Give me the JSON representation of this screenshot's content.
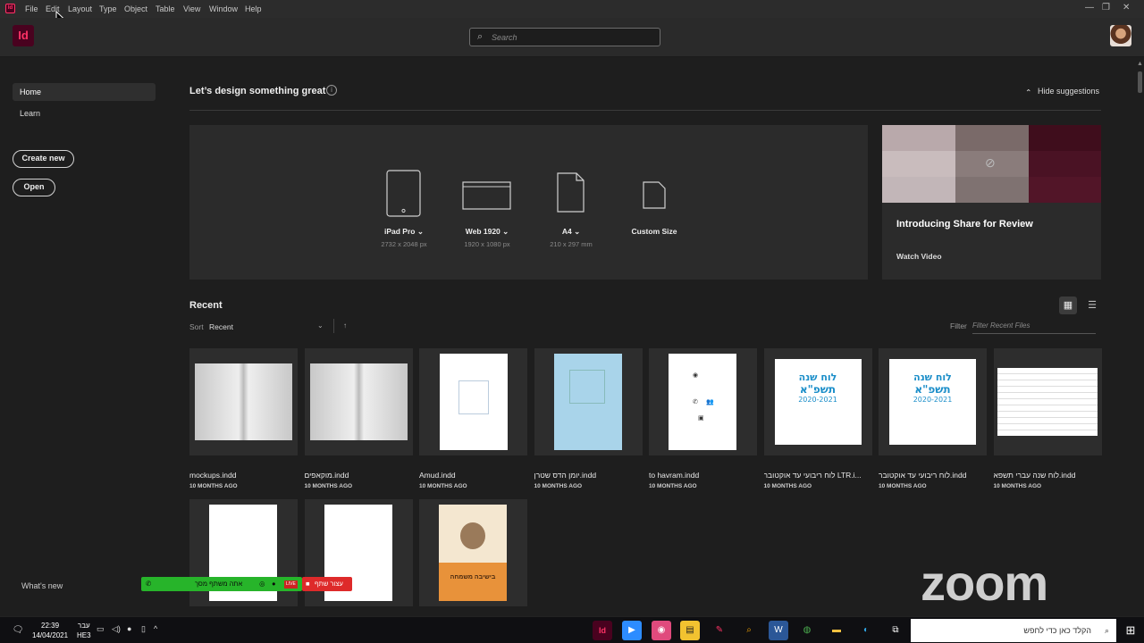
{
  "menubar": {
    "items": [
      "File",
      "Edit",
      "Layout",
      "Type",
      "Object",
      "Table",
      "View",
      "Window",
      "Help"
    ],
    "controls": [
      "—",
      "❐",
      "✕"
    ]
  },
  "app": {
    "logo": "Id"
  },
  "search": {
    "placeholder": "Search"
  },
  "sidebar": {
    "items": [
      {
        "label": "Home",
        "active": true
      },
      {
        "label": "Learn",
        "active": false
      }
    ],
    "create_label": "Create new",
    "open_label": "Open",
    "whats_new": "What's new"
  },
  "main": {
    "heading": "Let’s design something great",
    "hide_label": "Hide suggestions",
    "presets": [
      {
        "name": "iPad Pro",
        "size": "2732 x 2048 px",
        "icon": "tablet-icon",
        "dropdown": true
      },
      {
        "name": "Web 1920",
        "size": "1920 x 1080 px",
        "icon": "browser-window-icon",
        "dropdown": true
      },
      {
        "name": "A4",
        "size": "210 x 297 mm",
        "icon": "document-icon",
        "dropdown": true
      },
      {
        "name": "Custom Size",
        "size": "",
        "icon": "custom-document-icon",
        "dropdown": false
      }
    ],
    "promo": {
      "title": "Introducing Share for Review",
      "link": "Watch Video",
      "swatches": [
        "#b9a9ab",
        "#7a6a69",
        "#3f0d1c",
        "#c9bcbd",
        "#8a7c7b",
        "#4a1224",
        "#c2b6b8",
        "#7f7271",
        "#521528"
      ]
    },
    "recent": {
      "heading": "Recent",
      "sort_label": "Sort",
      "sort_value": "Recent",
      "filter_label": "Filter",
      "filter_placeholder": "Filter Recent Files",
      "files": [
        {
          "name": "mockups.indd",
          "age": "10 MONTHS AGO",
          "thumb": "book"
        },
        {
          "name": "מוקאפים.indd",
          "age": "10 MONTHS AGO",
          "thumb": "book"
        },
        {
          "name": "Amud.indd",
          "age": "10 MONTHS AGO",
          "thumb": "plain"
        },
        {
          "name": "יומן הדס שטרן.indd",
          "age": "10 MONTHS AGO",
          "thumb": "blue"
        },
        {
          "name": "to havram.indd",
          "age": "10 MONTHS AGO",
          "thumb": "icons"
        },
        {
          "name": "לוח ריבועי עד אוקטובר LTR.i...",
          "age": "10 MONTHS AGO",
          "thumb": "calendar"
        },
        {
          "name": "לוח ריבועי עד אוקטובר.indd",
          "age": "10 MONTHS AGO",
          "thumb": "calendar"
        },
        {
          "name": "לוח שנה עברי תשפא.indd",
          "age": "10 MONTHS AGO",
          "thumb": "table"
        }
      ],
      "row2": [
        "blank",
        "blank",
        "cover"
      ],
      "calendar_title": "לוח שנה",
      "calendar_year": "תשפ\"א",
      "calendar_range": "2020-2021",
      "cover_title": "בישיבה משמחה"
    }
  },
  "zoom": {
    "logo": "zoom",
    "share_status": "אתה משתף מסך",
    "stop_share": "עצור שתף",
    "live": "LIVE"
  },
  "taskbar": {
    "time": "22:39",
    "date": "14/04/2021",
    "lang": "עבר",
    "lang2": "HE3",
    "search_placeholder": "הקלד כאן כדי לחפש"
  }
}
